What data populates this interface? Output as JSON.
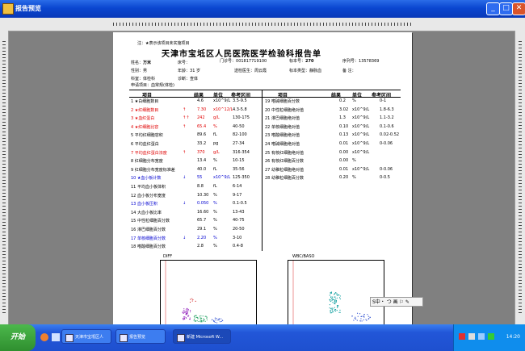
{
  "window": {
    "title": "报告预览"
  },
  "report": {
    "note": "注：★表示该项目未实施项目",
    "title": "天津市宝坻区人民医院医学检验科报告单",
    "name_label": "姓名：",
    "name": "万米",
    "bed_label": "床号：",
    "bed": "",
    "outpatient_label": "门诊号：",
    "outpatient": "001817719100",
    "specimen_no_label": "标本号：",
    "specimen_no": "270",
    "serial_label": "序列号：",
    "serial": "13578369",
    "sex_label": "性别：",
    "sex": "男",
    "age_label": "年龄：",
    "age": "31 岁",
    "doctor_label": "送检医生：",
    "doctor": "周云霞",
    "specimen_type_label": "标本类型：",
    "specimen_type": "静脉血",
    "remark_label": "备 注：",
    "remark": "",
    "dept_label": "科室：",
    "dept": "体检科",
    "diag_label": "诊断：",
    "diag": "查体",
    "apply_label": "申请项目：",
    "apply": "血常规(体检)"
  },
  "table": {
    "headers": [
      "项目",
      "结果",
      "单位",
      "参考区间"
    ],
    "left_rows": [
      {
        "name": "1 ★白细胞数目",
        "flag": "",
        "result": "4.6",
        "unit": "x10^9/L",
        "range": "3.5-9.5",
        "color": "black"
      },
      {
        "name": "2 ★红细胞数目",
        "flag": "↑",
        "result": "7.30",
        "unit": "x10^12/L",
        "range": "4.3-5.8",
        "color": "red"
      },
      {
        "name": "3 ★血红蛋白",
        "flag": "↑↑",
        "result": "242",
        "unit": "g/L",
        "range": "130-175",
        "color": "red"
      },
      {
        "name": "4 ★红细胞比容",
        "flag": "↑",
        "result": "65.4",
        "unit": "%",
        "range": "40-50",
        "color": "red"
      },
      {
        "name": "5 平均红细胞容积",
        "flag": "",
        "result": "89.6",
        "unit": "fL",
        "range": "82-100",
        "color": "black"
      },
      {
        "name": "6 平均血红蛋白",
        "flag": "",
        "result": "33.2",
        "unit": "pg",
        "range": "27-34",
        "color": "black"
      },
      {
        "name": "7 平均血红蛋白浓度",
        "flag": "↑",
        "result": "370",
        "unit": "g/L",
        "range": "316-354",
        "color": "red"
      },
      {
        "name": "8 红细胞分布宽度",
        "flag": "",
        "result": "13.4",
        "unit": "%",
        "range": "10-15",
        "color": "black"
      },
      {
        "name": "9 红细胞分布宽度标准差",
        "flag": "",
        "result": "40.0",
        "unit": "fL",
        "range": "35-56",
        "color": "black"
      },
      {
        "name": "10 ★血小板计数",
        "flag": "↓",
        "result": "55",
        "unit": "x10^9/L",
        "range": "125-350",
        "color": "blue"
      },
      {
        "name": "11 平均血小板体积",
        "flag": "",
        "result": "8.8",
        "unit": "fL",
        "range": "6-14",
        "color": "black"
      },
      {
        "name": "12 血小板分布宽度",
        "flag": "",
        "result": "10.30",
        "unit": "%",
        "range": "9-17",
        "color": "black"
      },
      {
        "name": "13 血小板压积",
        "flag": "↓",
        "result": "0.050",
        "unit": "%",
        "range": "0.1-0.5",
        "color": "blue"
      },
      {
        "name": "14 大血小板比率",
        "flag": "",
        "result": "16.60",
        "unit": "%",
        "range": "13-43",
        "color": "black"
      },
      {
        "name": "15 中性粒细胞百分数",
        "flag": "",
        "result": "65.7",
        "unit": "%",
        "range": "40-75",
        "color": "black"
      },
      {
        "name": "16 淋巴细胞百分数",
        "flag": "",
        "result": "29.1",
        "unit": "%",
        "range": "20-50",
        "color": "black"
      },
      {
        "name": "17 单核细胞百分数",
        "flag": "↓",
        "result": "2.20",
        "unit": "%",
        "range": "3-10",
        "color": "blue"
      },
      {
        "name": "18 嗜酸细胞百分数",
        "flag": "",
        "result": "2.8",
        "unit": "%",
        "range": "0.4-8",
        "color": "black"
      }
    ],
    "right_rows": [
      {
        "name": "19 嗜碱细胞百分数",
        "result": "0.2",
        "unit": "%",
        "range": "0-1"
      },
      {
        "name": "20 中性粒细胞绝对值",
        "result": "3.02",
        "unit": "x10^9/L",
        "range": "1.8-6.3"
      },
      {
        "name": "21 淋巴细胞绝对值",
        "result": "1.3",
        "unit": "x10^9/L",
        "range": "1.1-3.2"
      },
      {
        "name": "22 单核细胞绝对值",
        "result": "0.10",
        "unit": "x10^9/L",
        "range": "0.1-0.6"
      },
      {
        "name": "23 嗜酸细胞绝对值",
        "result": "0.13",
        "unit": "x10^9/L",
        "range": "0.02-0.52"
      },
      {
        "name": "24 嗜碱细胞绝对值",
        "result": "0.01",
        "unit": "x10^9/L",
        "range": "0-0.06"
      },
      {
        "name": "25 有核红细胞绝对值",
        "result": "0.00",
        "unit": "x10^9/L",
        "range": ""
      },
      {
        "name": "26 有核红细胞百分数",
        "result": "0.00",
        "unit": "%",
        "range": ""
      },
      {
        "name": "27 幼稚粒细胞绝对值",
        "result": "0.01",
        "unit": "x10^9/L",
        "range": "0-0.06"
      },
      {
        "name": "28 幼稚粒细胞百分数",
        "result": "0.20",
        "unit": "%",
        "range": "0-0.5"
      }
    ]
  },
  "plots": {
    "left_title": "DIFF",
    "right_title": "WBC/BASO"
  },
  "ime": {
    "label": "S中・ つ 画 ⚐ ✎"
  },
  "taskbar": {
    "start": "开始",
    "items": [
      "天津市宝坻区人民...",
      "报告预览",
      "新建 Microsoft W..."
    ],
    "clock": "14:20"
  }
}
